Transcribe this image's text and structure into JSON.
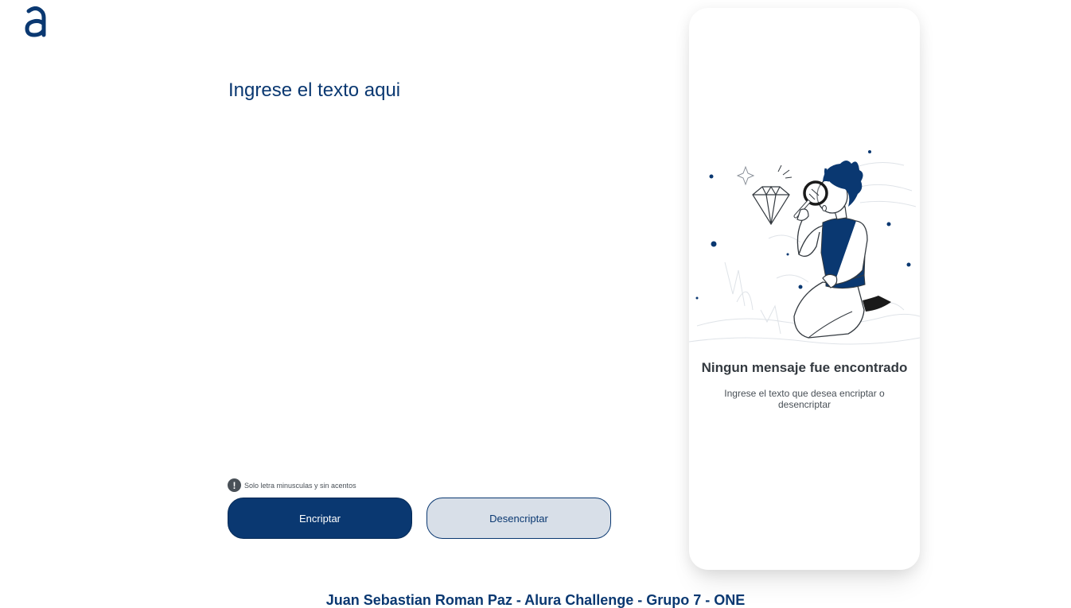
{
  "brand": {
    "logo_icon": "alura-a-logo-icon",
    "color": "#0a3871"
  },
  "input": {
    "placeholder": "Ingrese el texto aqui",
    "value": ""
  },
  "hint": {
    "icon": "exclamation-circle-icon",
    "text": "Solo letra minusculas y sin acentos"
  },
  "buttons": {
    "encrypt_label": "Encriptar",
    "decrypt_label": "Desencriptar"
  },
  "output_panel": {
    "illustration": "person-with-magnifying-glass-illustration",
    "title": "Ningun mensaje fue encontrado",
    "subtitle": "Ingrese el texto que desea encriptar o desencriptar"
  },
  "footer": {
    "text": "Juan Sebastian Roman Paz - Alura Challenge - Grupo 7 - ONE"
  },
  "colors": {
    "primary": "#0a3871",
    "secondary_bg": "#d8dfe8",
    "text_dark": "#343a40",
    "text_muted": "#495057"
  }
}
